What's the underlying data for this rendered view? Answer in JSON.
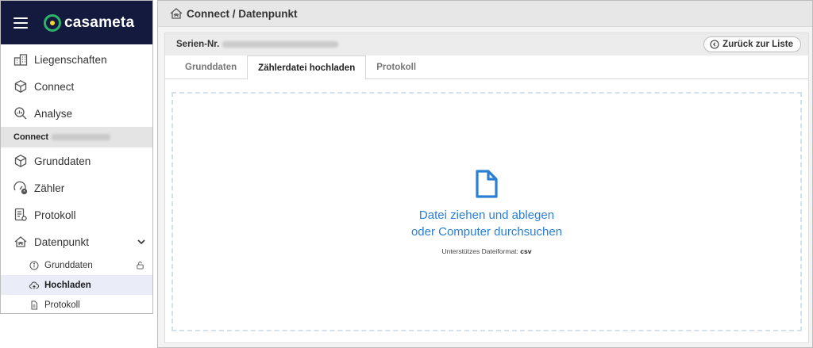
{
  "brand": {
    "name": "casameta"
  },
  "sidebar": {
    "top_items": [
      {
        "label": "Liegenschaften"
      },
      {
        "label": "Connect"
      },
      {
        "label": "Analyse"
      }
    ],
    "section_label": "Connect",
    "section_items": [
      {
        "label": "Grunddaten"
      },
      {
        "label": "Zähler"
      },
      {
        "label": "Protokoll"
      },
      {
        "label": "Datenpunkt"
      }
    ],
    "sub_items": [
      {
        "label": "Grunddaten"
      },
      {
        "label": "Hochladen"
      },
      {
        "label": "Protokoll"
      }
    ]
  },
  "main": {
    "title": "Connect / Datenpunkt",
    "serial_label": "Serien-Nr.",
    "back_label": "Zurück zur Liste",
    "tabs": [
      {
        "label": "Grunddaten"
      },
      {
        "label": "Zählerdatei hochladen"
      },
      {
        "label": "Protokoll"
      }
    ],
    "dropzone": {
      "line1": "Datei ziehen und ablegen",
      "line2": "oder Computer durchsuchen",
      "note_prefix": "Unterstützes Dateiformat:",
      "note_format": "csv"
    }
  },
  "colors": {
    "brand_bg": "#131a3d",
    "accent_blue": "#2a7ed3",
    "active_sub_bg": "#eaedf7"
  }
}
